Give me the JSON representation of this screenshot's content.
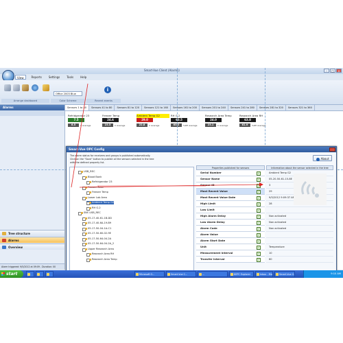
{
  "window": {
    "title": "Smart-Vue Client (Alarms)"
  },
  "menu": [
    "View",
    "Reports",
    "Settings",
    "Tools",
    "Help"
  ],
  "ribbon": {
    "color_scheme_value": "Office 2003 Blue",
    "groups": [
      "Arrange dashboard",
      "Color Scheme",
      "Recent events"
    ]
  },
  "left_pane": {
    "title": "Alarms",
    "nav": [
      "Tree structure",
      "Alarms",
      "Overview"
    ],
    "alarm_status": "Alarm triggered: 9/5/2012 at 09:09 - Duration: 00"
  },
  "tabs": [
    "Sensors 1 to 40",
    "Sensors 41 to 80",
    "Sensors 81 to 120",
    "Sensors 121 to 160",
    "Sensors 161 to 200",
    "Sensors 201 to 240",
    "Sensors 241 to 280",
    "Sensors 281 to 320",
    "Sensors 321 to 360"
  ],
  "sensors": [
    {
      "name": "Refridgerator 23",
      "value": "7.5",
      "color": "#2a7a2a",
      "small": "6.5",
      "small_color": "#555555",
      "avg": "C Average"
    },
    {
      "name": "Freezer Temp",
      "value": "24.6",
      "color": "#1a1a1a",
      "small": "23.5",
      "small_color": "#555555",
      "avg": "C Average"
    },
    {
      "name": "Ambient Temp G2",
      "value": "29.0",
      "color": "#c81e1e",
      "small": "22.8",
      "small_color": "#555555",
      "avg": "C Average"
    },
    {
      "name": "RH G-2",
      "value": "63.5",
      "color": "#1a1a1a",
      "small": "63.3",
      "small_color": "#555555",
      "avg": "%RH Average"
    },
    {
      "name": "Research Area Temp",
      "value": "24.0",
      "color": "#1a1a1a",
      "small": "23.1",
      "small_color": "#555555",
      "avg": "C Average"
    },
    {
      "name": "Research Area RH",
      "value": "63.8",
      "color": "#1a1a1a",
      "small": "61.9",
      "small_color": "#555555",
      "avg": "%RH Average"
    }
  ],
  "dialog": {
    "title": "Smart-Vue OPC Config",
    "description": [
      "The alarm status for receivers and groups is published automatically.",
      "Click on the \"Save\" button to publish all the sensors selected in the tree",
      "with the defined property list."
    ],
    "about_label": "About",
    "col_properties": "Properties published for sensors",
    "col_info": "Information about the sensor selected in the tree",
    "tree": [
      {
        "label": "USB_REC",
        "indent": 1
      },
      {
        "label": "Blood Bank",
        "indent": 2
      },
      {
        "label": "Refridgerator 23",
        "indent": 3
      },
      {
        "label": "Freezer Area",
        "indent": 2
      },
      {
        "label": "Freezer Temp",
        "indent": 3
      },
      {
        "label": "Lower Lab Area",
        "indent": 2
      },
      {
        "label": "Ambient Temp G2",
        "indent": 3,
        "selected": true
      },
      {
        "label": "RH G-2",
        "indent": 3
      },
      {
        "label": "SNF-USB_REC",
        "indent": 1
      },
      {
        "label": "05-17-40-61-1B-DD",
        "indent": 2
      },
      {
        "label": "05-17-40-6A-19-B9",
        "indent": 2
      },
      {
        "label": "05-17-50-04-1A-C1",
        "indent": 2
      },
      {
        "label": "05-17-50-60-02-9E",
        "indent": 2
      },
      {
        "label": "05-17-50-64-04-2A",
        "indent": 2
      },
      {
        "label": "05-17-50-64-04-2A_2",
        "indent": 2
      },
      {
        "label": "Upper Research Area",
        "indent": 2
      },
      {
        "label": "Research Area RH",
        "indent": 3
      },
      {
        "label": "Research Area Temp",
        "indent": 3
      }
    ],
    "properties": [
      "Serial Number",
      "Sensor Name",
      "Sensor ID",
      "Most Recent Value",
      "Most Recent Value Date",
      "High Limit",
      "Low Limit",
      "High Alarm Delay",
      "Low Alarm Delay",
      "Alarm Code",
      "Alarm Value",
      "Alarm Start Date",
      "Unit",
      "Measurement interval",
      "Transfer interval"
    ],
    "info_values": [
      "Ambient Temp G2",
      "05-20-50-61-15-8E",
      "3",
      "29",
      "9/5/2012 9:09:37 AM",
      "28",
      "",
      "Non activated",
      "Non activated",
      "Non activated",
      "",
      "",
      "Temperature",
      "10",
      "60"
    ]
  },
  "taskbar": {
    "start": "start",
    "buttons": [
      "",
      "",
      "",
      "Microsoft O...",
      "Smart-Vue C...",
      "...",
      "KEPC Explorer",
      "Inbox - Micr...",
      "Smart-Vue O..."
    ],
    "clock": "9:10 AM"
  },
  "colors": {
    "accent": "#3166b6",
    "alarm": "#c81e1e",
    "highlight": "#ffee00",
    "taskbar": "#2452b8"
  }
}
